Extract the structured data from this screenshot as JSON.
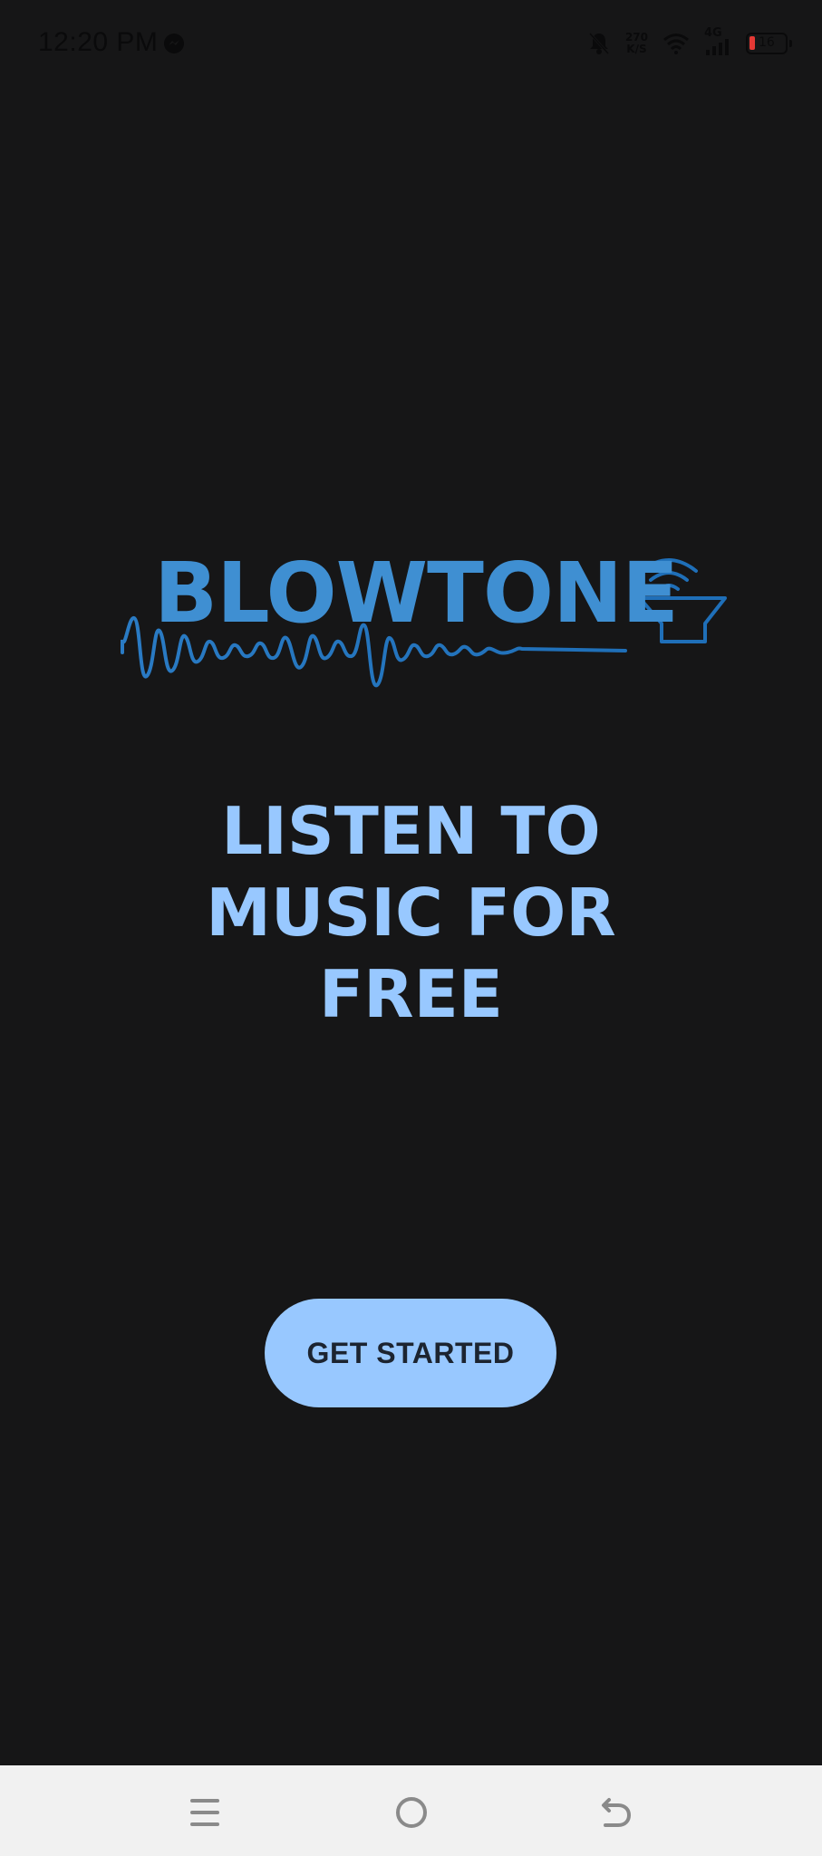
{
  "status_bar": {
    "time": "12:20 PM",
    "network_speed_value": "270",
    "network_speed_unit": "K/S",
    "network_type": "4G",
    "battery_percent": "16",
    "icons": [
      "messenger-icon",
      "mute-icon",
      "speed-icon",
      "wifi-icon",
      "signal-icon",
      "battery-icon"
    ]
  },
  "logo": {
    "text": "BLOWTONE",
    "color": "#3f8fd2"
  },
  "tagline": {
    "line1": "LISTEN TO",
    "line2": "MUSIC FOR",
    "line3": "FREE",
    "color": "#98c8ff"
  },
  "cta": {
    "label": "GET STARTED",
    "background": "#98c8ff"
  },
  "nav_bar": {
    "icons": [
      "menu-icon",
      "home-icon",
      "back-icon"
    ]
  },
  "colors": {
    "background": "#161617",
    "nav_background": "#f1f1f1"
  }
}
